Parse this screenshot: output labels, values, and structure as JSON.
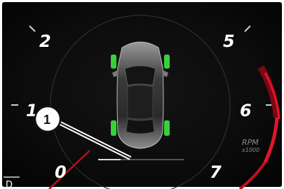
{
  "gauge": {
    "numerals": [
      "0",
      "1",
      "2",
      "5",
      "6",
      "7"
    ],
    "rpm_label": "RPM",
    "rpm_multiplier": "x1000",
    "gear_indicator": "D",
    "colors": {
      "background": "#0d0d0d",
      "redline": "#e0162b",
      "tire_ok": "#35d23a",
      "numeral": "#ffffff"
    }
  },
  "tire_status": [
    "ok",
    "ok",
    "ok",
    "ok"
  ],
  "callout": {
    "number": "1"
  },
  "icons": {
    "vehicle": "car-top-view-icon",
    "tires": "tire-indicator-icon"
  }
}
